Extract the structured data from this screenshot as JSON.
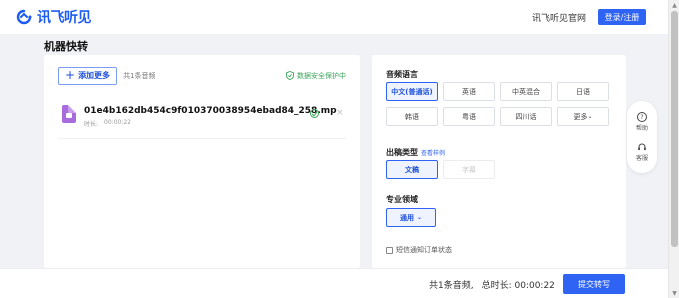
{
  "header": {
    "logo_text": "讯飞听见",
    "official_site": "讯飞听见官网",
    "login_label": "登录/注册",
    "brand_color": "#2f63f3"
  },
  "page": {
    "title": "机器快转"
  },
  "upload": {
    "add_more_label": "添加更多",
    "file_count": "共1条音频",
    "secure_label": "数据安全保护中"
  },
  "files": [
    {
      "name": "01e4b162db454c9f010370038954ebad84_258.mp",
      "duration_label": "时长:",
      "duration": "00:00:22"
    }
  ],
  "settings": {
    "language_title": "音频语言",
    "languages": [
      "中文(普通话)",
      "英语",
      "中英混合",
      "日语",
      "韩语",
      "粤语",
      "四川话"
    ],
    "more_label": "更多",
    "output_title": "出稿类型",
    "view_sample": "查看样例",
    "output_types": [
      {
        "label": "文稿",
        "active": true
      },
      {
        "label": "字幕",
        "active": false
      }
    ],
    "domain_title": "专业领域",
    "domain_value": "通用",
    "sms_label": "短信通知订单状态"
  },
  "tools": {
    "help_label": "帮助",
    "service_label": "客服"
  },
  "footer": {
    "total_audio": "共1条音频,",
    "total_duration": "总时长: 00:00:22",
    "submit_label": "提交转写"
  }
}
